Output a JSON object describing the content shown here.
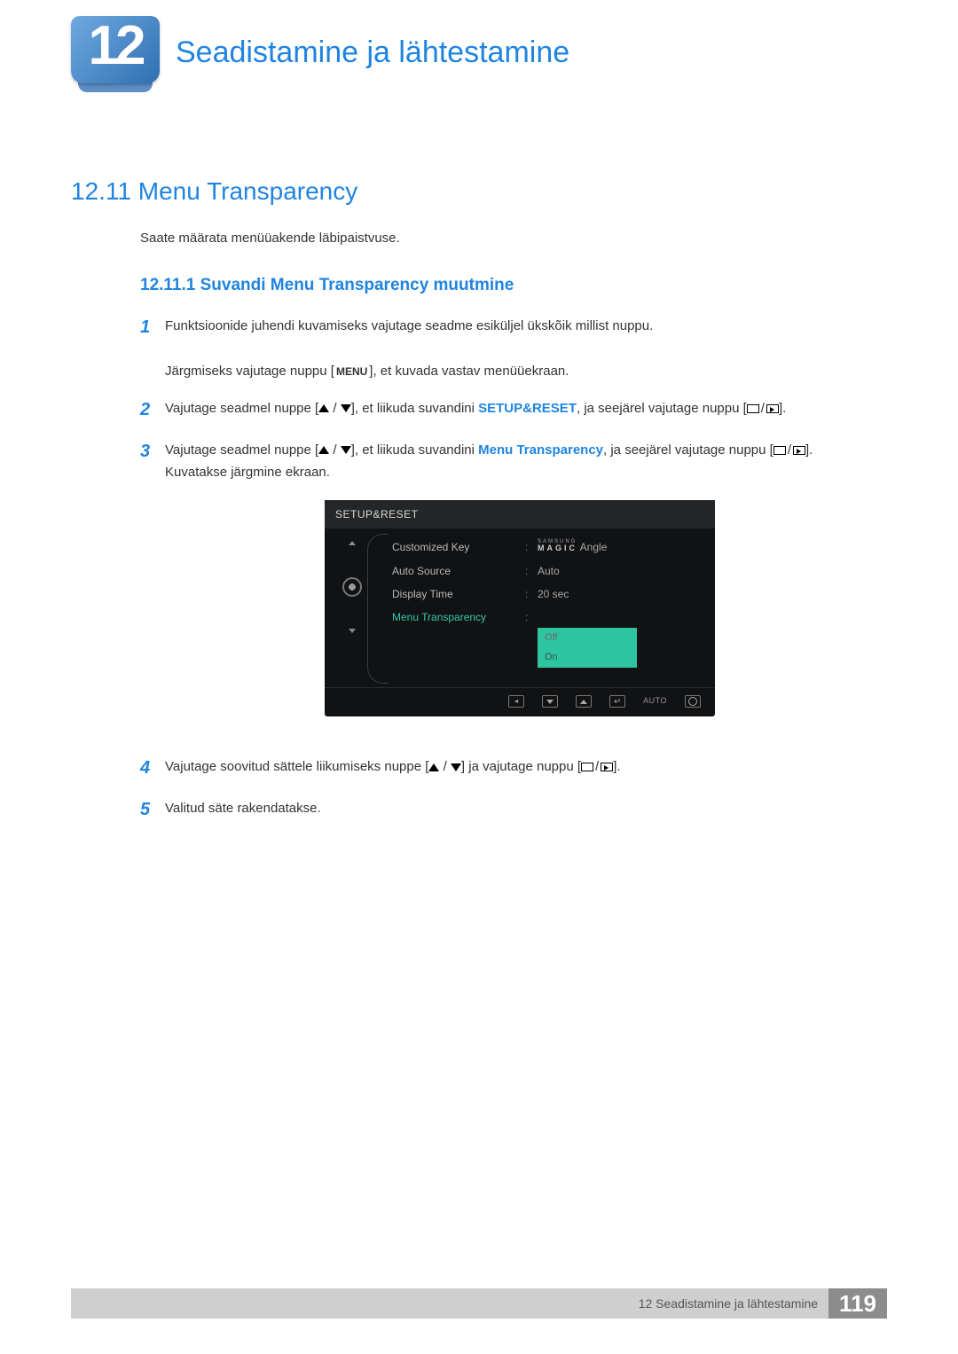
{
  "chapter": {
    "number": "12",
    "title": "Seadistamine ja lähtestamine"
  },
  "section": {
    "heading": "12.11 Menu Transparency",
    "intro": "Saate määrata menüüakende läbipaistvuse.",
    "subheading": "12.11.1   Suvandi Menu Transparency muutmine"
  },
  "steps": {
    "s1": {
      "num": "1",
      "line1": "Funktsioonide juhendi kuvamiseks vajutage seadme esiküljel ükskõik millist nuppu.",
      "line2a": "Järgmiseks vajutage nuppu [",
      "menu_key": "MENU",
      "line2b": "], et kuvada vastav menüüekraan."
    },
    "s2": {
      "num": "2",
      "a": "Vajutage seadmel nuppe [",
      "b": "], et liikuda suvandini ",
      "kw": "SETUP&RESET",
      "c": ", ja seejärel vajutage nuppu [",
      "d": "]."
    },
    "s3": {
      "num": "3",
      "a": "Vajutage seadmel nuppe [",
      "b": "], et liikuda suvandini ",
      "kw": "Menu Transparency",
      "c": ", ja seejärel vajutage nuppu [",
      "d": "].",
      "e": "Kuvatakse järgmine ekraan."
    },
    "s4": {
      "num": "4",
      "a": "Vajutage soovitud sättele liikumiseks nuppe [",
      "b": "] ja vajutage nuppu [",
      "c": "]."
    },
    "s5": {
      "num": "5",
      "text": "Valitud säte rakendatakse."
    }
  },
  "osd": {
    "title": "SETUP&RESET",
    "rows": [
      {
        "label": "Customized Key",
        "value_type": "brand",
        "value": "Angle"
      },
      {
        "label": "Auto Source",
        "value": "Auto"
      },
      {
        "label": "Display Time",
        "value": "20 sec"
      },
      {
        "label": "Menu Transparency",
        "active": true
      }
    ],
    "options": {
      "off": "Off",
      "on": "On"
    },
    "brand": {
      "top": "SAMSUNG",
      "bottom": "MAGIC"
    },
    "bottom_bar": {
      "auto": "AUTO"
    }
  },
  "footer": {
    "text": "12 Seadistamine ja lähtestamine",
    "page": "119"
  }
}
